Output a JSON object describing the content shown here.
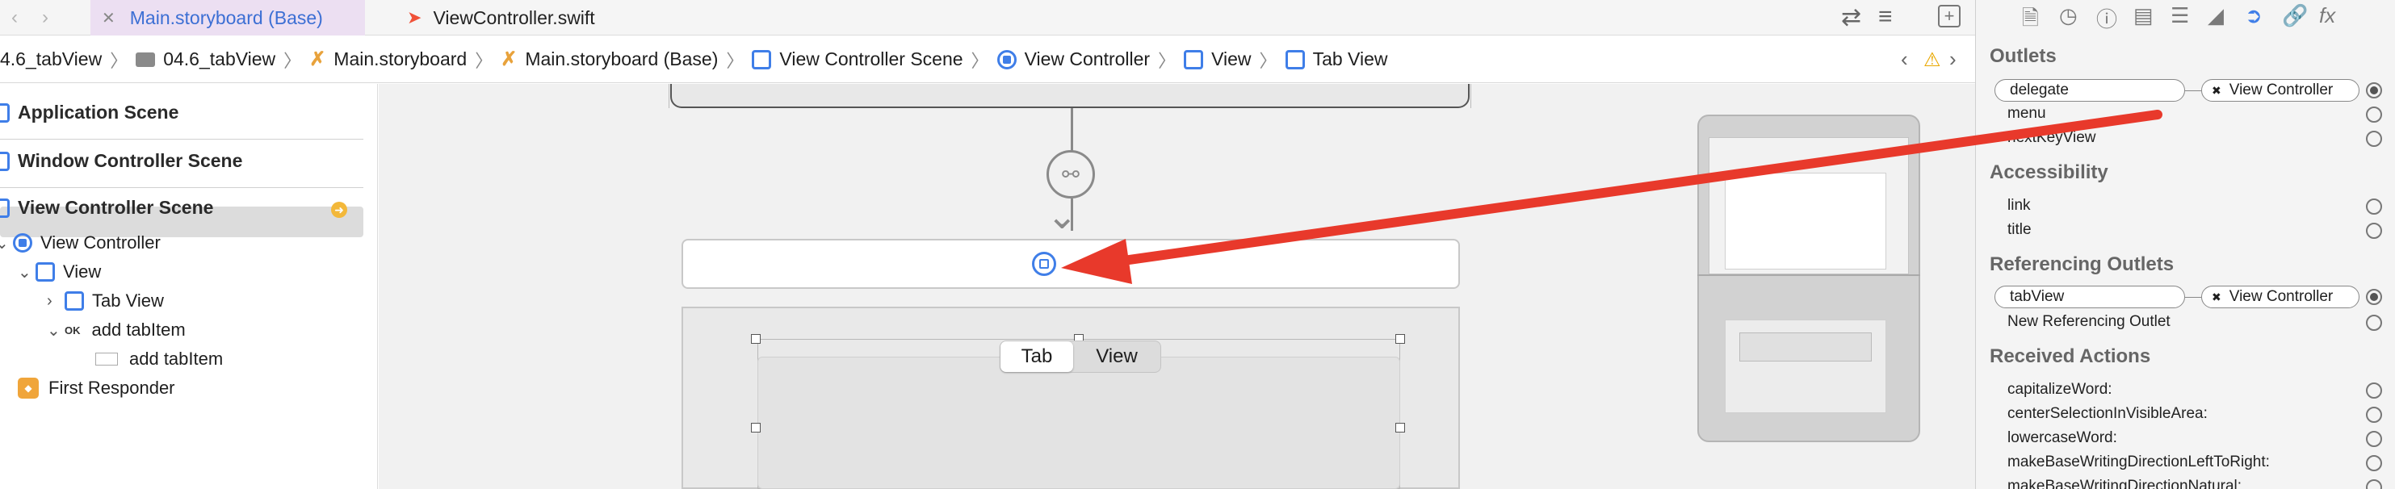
{
  "tabs": {
    "file1": "Main.storyboard (Base)",
    "file2": "ViewController.swift"
  },
  "breadcrumbs": [
    "4.6_tabView",
    "04.6_tabView",
    "Main.storyboard",
    "Main.storyboard (Base)",
    "View Controller Scene",
    "View Controller",
    "View",
    "Tab View"
  ],
  "outline": {
    "app_scene": "Application Scene",
    "window_scene": "Window Controller Scene",
    "vc_scene": "View Controller Scene",
    "vc": "View Controller",
    "view": "View",
    "tab_view": "Tab View",
    "add_tab_item": "add tabItem",
    "add_tab_item_child": "add tabItem",
    "first_responder": "First Responder"
  },
  "canvas": {
    "segment_tab": "Tab",
    "segment_view": "View"
  },
  "inspector": {
    "outlets_header": "Outlets",
    "delegate": "delegate",
    "delegate_target": "View Controller",
    "menu": "menu",
    "next_key_view": "nextKeyView",
    "accessibility_header": "Accessibility",
    "link": "link",
    "title": "title",
    "ref_outlets_header": "Referencing Outlets",
    "tab_view": "tabView",
    "tab_view_target": "View Controller",
    "new_ref_outlet": "New Referencing Outlet",
    "received_actions_header": "Received Actions",
    "actions": [
      "capitalizeWord:",
      "centerSelectionInVisibleArea:",
      "lowercaseWord:",
      "makeBaseWritingDirectionLeftToRight:",
      "makeBaseWritingDirectionNatural:"
    ]
  },
  "colors": {
    "accent": "#3f7ee8",
    "arrow": "#e8392b",
    "tab_active_bg": "#ecdff2"
  }
}
